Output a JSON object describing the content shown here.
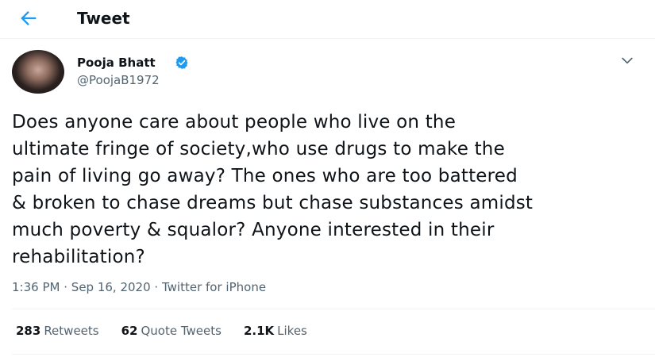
{
  "header": {
    "title": "Tweet",
    "back_icon": "arrow-left-icon"
  },
  "author": {
    "name": "Pooja Bhatt",
    "handle": "@PoojaB1972",
    "verified_icon": "verified-badge-icon",
    "avatar": "avatar"
  },
  "tweet": {
    "text": "Does anyone care about people who live on the\nultimate fringe of society,who use drugs to make the\npain of living go away? The ones who are too battered\n& broken to chase dreams but chase substances amidst\nmuch poverty & squalor? Anyone interested in their\nrehabilitation?",
    "time": "1:36 PM",
    "date": "Sep 16, 2020",
    "source": "Twitter for iPhone",
    "separator": "·"
  },
  "stats": {
    "retweets": {
      "count": "283",
      "label": "Retweets"
    },
    "quote_tweets": {
      "count": "62",
      "label": "Quote Tweets"
    },
    "likes": {
      "count": "2.1K",
      "label": "Likes"
    }
  },
  "colors": {
    "accent": "#1d9bf0",
    "text": "#0f1419",
    "secondary": "#536471",
    "divider": "#eff3f4"
  }
}
